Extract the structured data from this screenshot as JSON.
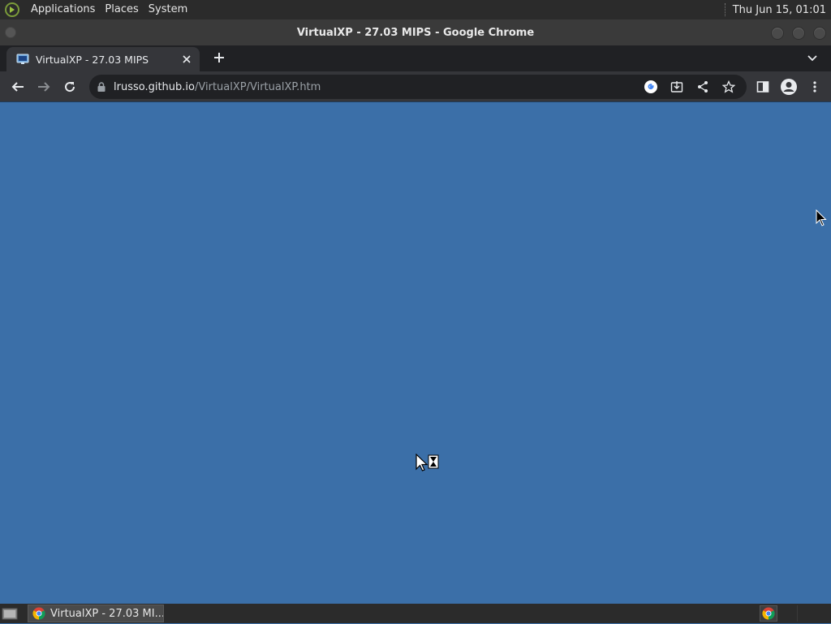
{
  "top_panel": {
    "menus": [
      "Applications",
      "Places",
      "System"
    ],
    "clock": "Thu Jun 15, 01:01"
  },
  "window": {
    "title": "VirtualXP - 27.03 MIPS - Google Chrome"
  },
  "browser": {
    "tab": {
      "title": "VirtualXP - 27.03 MIPS",
      "favicon": "monitor-icon"
    },
    "url_host": "lrusso.github.io",
    "url_path": "/VirtualXP/VirtualXP.htm"
  },
  "page": {
    "background": "#3b6fa8"
  },
  "taskbar": {
    "item_label": "VirtualXP - 27.03 MI..."
  },
  "colors": {
    "panel": "#2b2b2b",
    "chrome_dark": "#202124",
    "chrome_toolbar": "#35363a",
    "desktop_blue": "#3b6fa8"
  }
}
